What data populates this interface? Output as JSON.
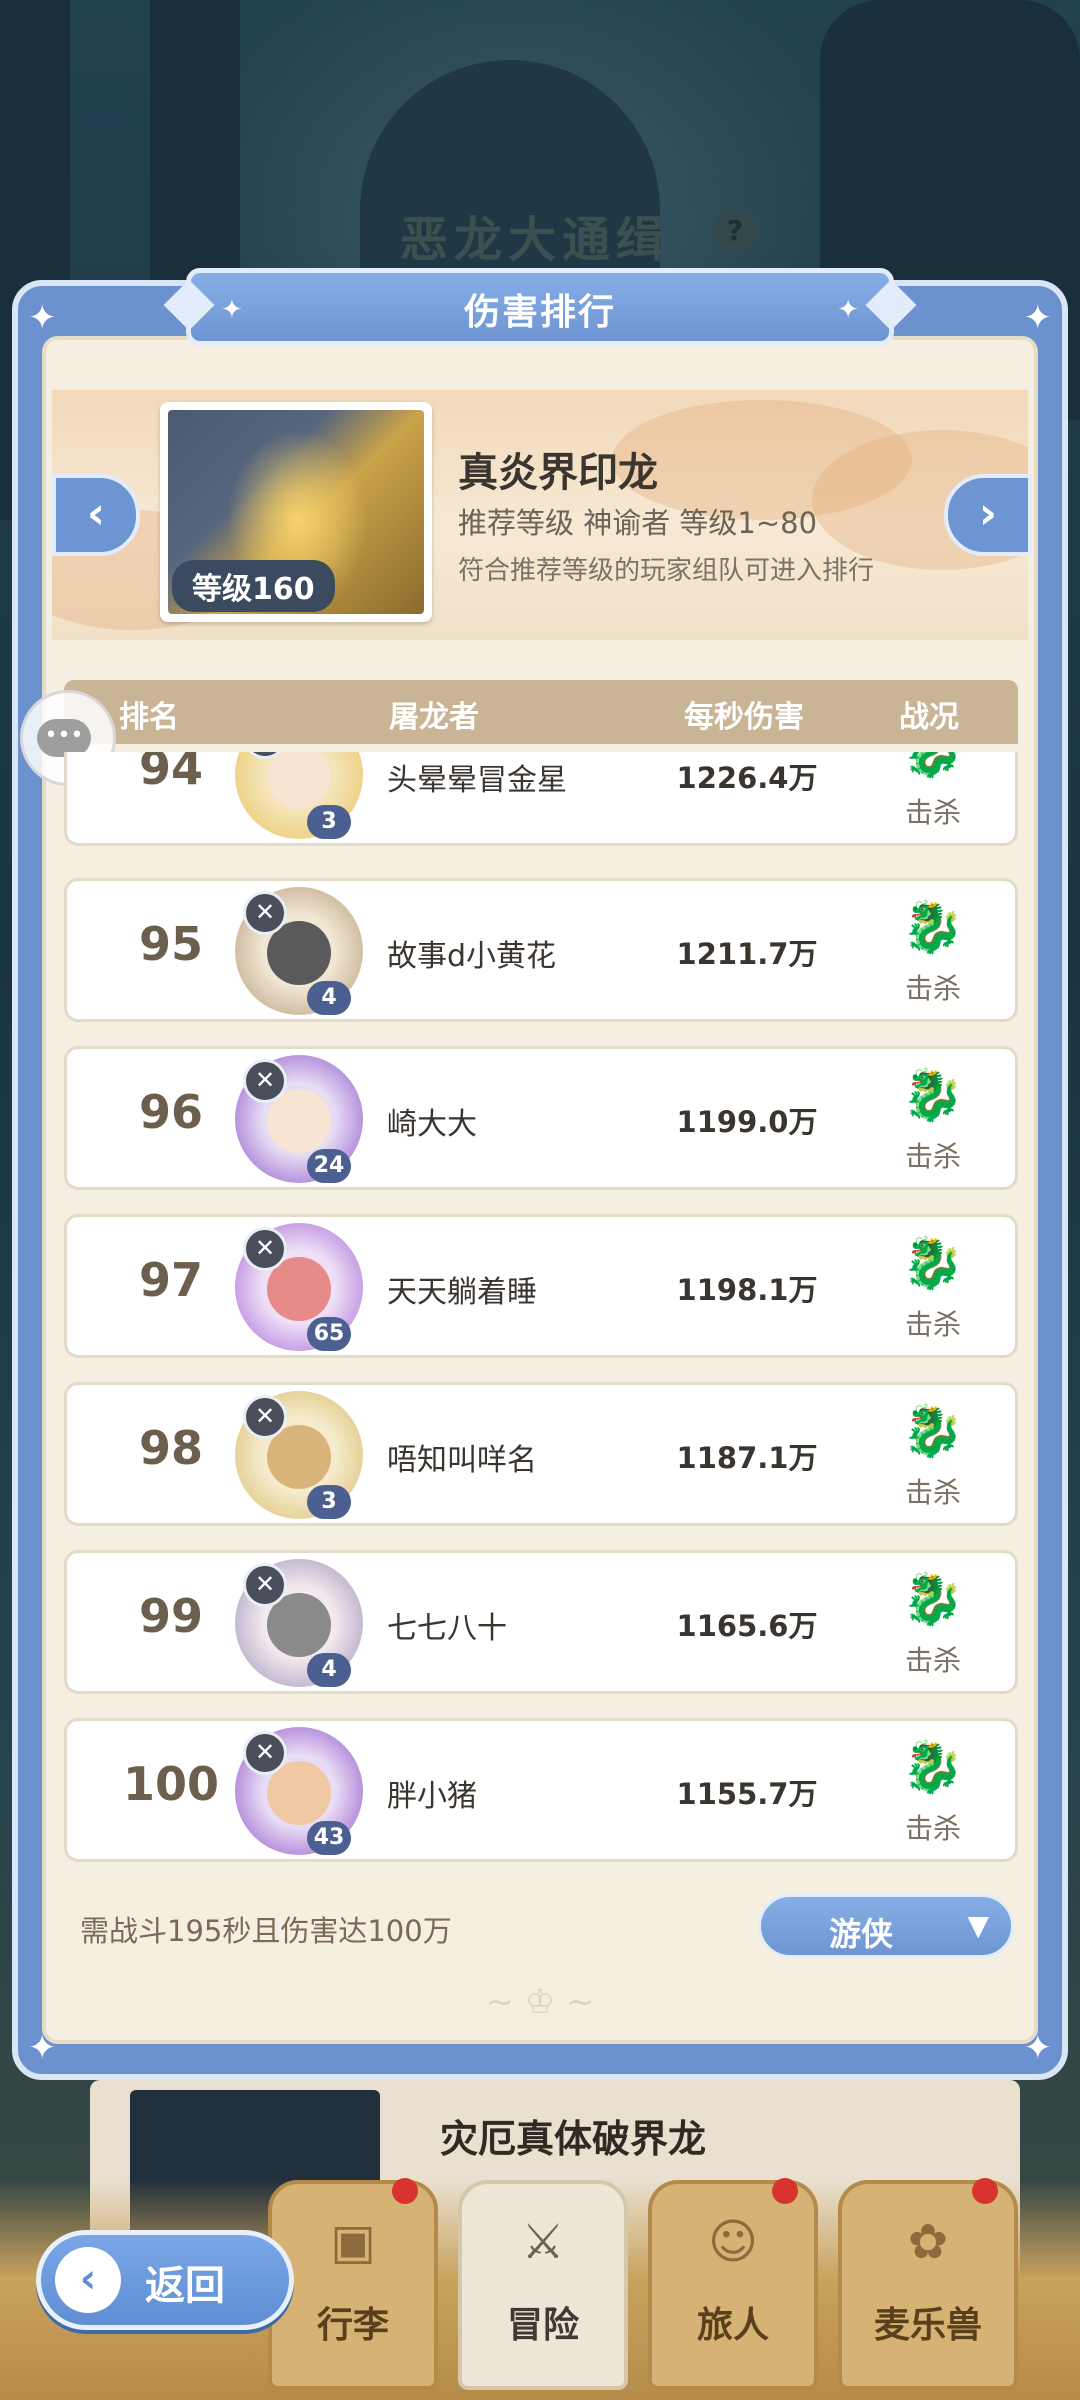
{
  "background": {
    "title": "恶龙大通缉",
    "next_item": {
      "title": "灾厄真体破界龙"
    }
  },
  "panel": {
    "title": "伤害排行",
    "boss": {
      "name": "真炎界印龙",
      "level_badge": "等级160",
      "recommend": "推荐等级  神谕者  等级1~80",
      "note": "符合推荐等级的玩家组队可进入排行"
    },
    "table_headers": {
      "rank": "排名",
      "player": "屠龙者",
      "dps": "每秒伤害",
      "status": "战况"
    },
    "rows": [
      {
        "rank": "94",
        "name": "头晕晕冒金星",
        "dps": "1226.4万",
        "status": "击杀",
        "level": "3"
      },
      {
        "rank": "95",
        "name": "故事d小黄花",
        "dps": "1211.7万",
        "status": "击杀",
        "level": "4"
      },
      {
        "rank": "96",
        "name": "崎大大",
        "dps": "1199.0万",
        "status": "击杀",
        "level": "24"
      },
      {
        "rank": "97",
        "name": "天天躺着睡",
        "dps": "1198.1万",
        "status": "击杀",
        "level": "65"
      },
      {
        "rank": "98",
        "name": "唔知叫咩名",
        "dps": "1187.1万",
        "status": "击杀",
        "level": "3"
      },
      {
        "rank": "99",
        "name": "七七八十",
        "dps": "1165.6万",
        "status": "击杀",
        "level": "4"
      },
      {
        "rank": "100",
        "name": "胖小猪",
        "dps": "1155.7万",
        "status": "击杀",
        "level": "43"
      }
    ],
    "requirement": "需战斗195秒且伤害达100万",
    "class_filter": {
      "selected": "游侠"
    }
  },
  "bottom_nav": {
    "back_label": "返回",
    "tabs": [
      {
        "label": "行李"
      },
      {
        "label": "冒险"
      },
      {
        "label": "旅人"
      },
      {
        "label": "麦乐兽"
      }
    ]
  },
  "colors": {
    "panel_blue": "#6b91cf",
    "parchment": "#f5efe2",
    "header_tan": "#c9b596",
    "level_badge": "#4b5f90"
  },
  "icons": [
    "chat-icon",
    "chevron-left-icon",
    "chevron-right-icon",
    "dragon-kill-icon",
    "class-emblem-icon",
    "caret-down-icon",
    "back-arrow-icon"
  ]
}
